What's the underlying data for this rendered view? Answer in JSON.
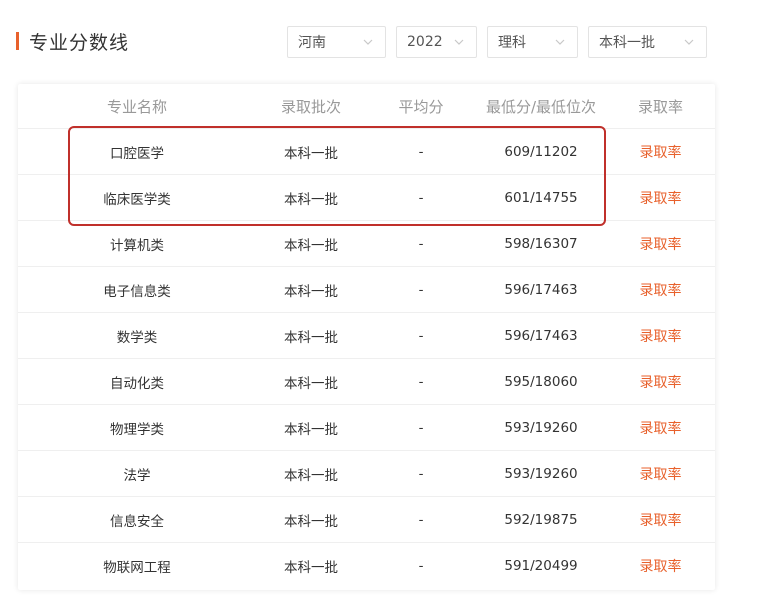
{
  "section": {
    "title": "专业分数线"
  },
  "filters": [
    {
      "value": "河南",
      "icon": "chevron-down-icon"
    },
    {
      "value": "2022",
      "icon": "chevron-down-icon"
    },
    {
      "value": "理科",
      "icon": "chevron-down-icon"
    },
    {
      "value": "本科一批",
      "icon": "chevron-down-icon"
    }
  ],
  "table": {
    "headers": [
      "专业名称",
      "录取批次",
      "平均分",
      "最低分/最低位次",
      "录取率"
    ],
    "rows": [
      {
        "major": "口腔医学",
        "batch": "本科一批",
        "avg": "-",
        "min": "609/11202",
        "rate": "录取率"
      },
      {
        "major": "临床医学类",
        "batch": "本科一批",
        "avg": "-",
        "min": "601/14755",
        "rate": "录取率"
      },
      {
        "major": "计算机类",
        "batch": "本科一批",
        "avg": "-",
        "min": "598/16307",
        "rate": "录取率"
      },
      {
        "major": "电子信息类",
        "batch": "本科一批",
        "avg": "-",
        "min": "596/17463",
        "rate": "录取率"
      },
      {
        "major": "数学类",
        "batch": "本科一批",
        "avg": "-",
        "min": "596/17463",
        "rate": "录取率"
      },
      {
        "major": "自动化类",
        "batch": "本科一批",
        "avg": "-",
        "min": "595/18060",
        "rate": "录取率"
      },
      {
        "major": "物理学类",
        "batch": "本科一批",
        "avg": "-",
        "min": "593/19260",
        "rate": "录取率"
      },
      {
        "major": "法学",
        "batch": "本科一批",
        "avg": "-",
        "min": "593/19260",
        "rate": "录取率"
      },
      {
        "major": "信息安全",
        "batch": "本科一批",
        "avg": "-",
        "min": "592/19875",
        "rate": "录取率"
      },
      {
        "major": "物联网工程",
        "batch": "本科一批",
        "avg": "-",
        "min": "591/20499",
        "rate": "录取率"
      }
    ]
  },
  "colors": {
    "accent": "#e8612c",
    "highlight": "#c0302b",
    "header_text": "#999999"
  }
}
